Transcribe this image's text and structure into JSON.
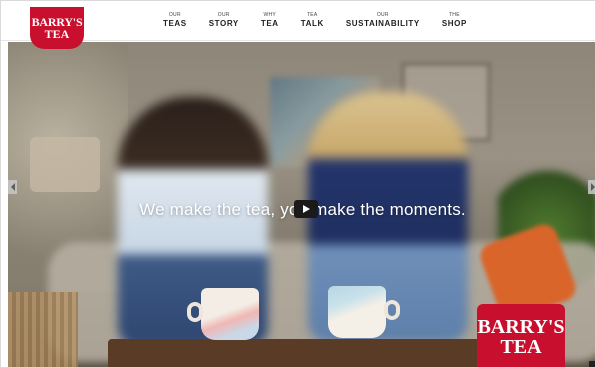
{
  "brand": {
    "logo_line1": "BARRY'S",
    "logo_line2": "TEA",
    "color": "#c8102e"
  },
  "nav": {
    "items": [
      {
        "small": "OUR",
        "big": "TEAS"
      },
      {
        "small": "OUR",
        "big": "STORY"
      },
      {
        "small": "WHY",
        "big": "TEA"
      },
      {
        "small": "TEA",
        "big": "TALK"
      },
      {
        "small": "OUR",
        "big": "SUSTAINABILITY"
      },
      {
        "small": "THE",
        "big": "SHOP"
      }
    ]
  },
  "hero": {
    "headline": "We make the tea, you make the moments.",
    "play_icon": "play-icon",
    "prev_icon": "chevron-left-icon",
    "next_icon": "chevron-right-icon"
  },
  "badge": {
    "line1": "BARRY'S",
    "line2": "TEA"
  }
}
